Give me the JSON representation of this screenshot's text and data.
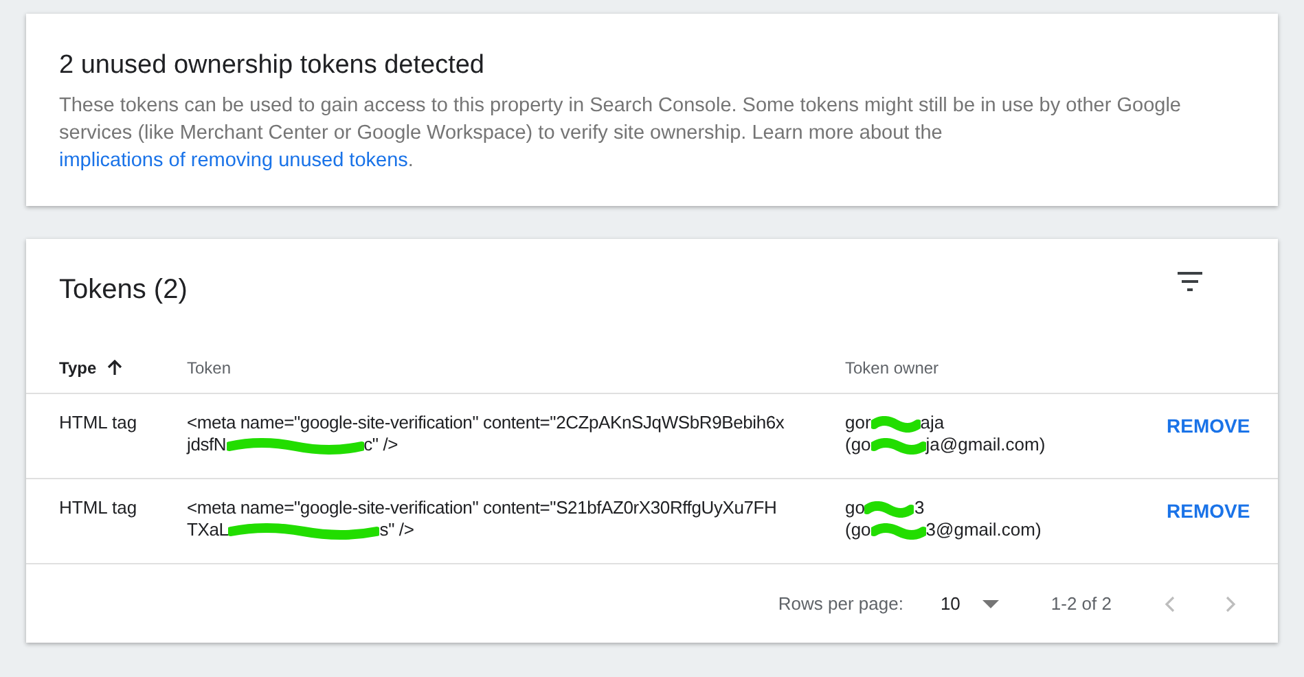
{
  "notice": {
    "title": "2 unused ownership tokens detected",
    "body": "These tokens can be used to gain access to this property in Search Console. Some tokens might still be in use by other Google services (like Merchant Center or Google Workspace) to verify site ownership. Learn more about the",
    "link": "implications of removing unused tokens",
    "end": "."
  },
  "tokens_card": {
    "title": "Tokens (2)",
    "columns": [
      {
        "label": "Type",
        "sorted": true
      },
      {
        "label": "Token",
        "sorted": false
      },
      {
        "label": "Token owner",
        "sorted": false
      }
    ],
    "rows": [
      {
        "type": "HTML tag",
        "token_line1": "<meta name=\"google-site-verification\" content=\"2CZpAKnSJqWSbR9Bebih6x",
        "token_line2_start": "jdsfN",
        "token_line2_end": "c\" />",
        "owner_name_start": "gor",
        "owner_name_end": "aja",
        "owner_email_start": "(go",
        "owner_email_end": "ja@gmail.com)",
        "action": "REMOVE"
      },
      {
        "type": "HTML tag",
        "token_line1": "<meta name=\"google-site-verification\" content=\"S21bfAZ0rX30RffgUyXu7FH",
        "token_line2_start": "TXaL",
        "token_line2_end": "s\" />",
        "owner_name_start": "go",
        "owner_name_end": "3",
        "owner_email_start": "(go",
        "owner_email_end": "3@gmail.com)",
        "action": "REMOVE"
      }
    ],
    "pagination": {
      "rows_label": "Rows per page:",
      "rows_value": "10",
      "range": "1-2 of 2"
    }
  }
}
